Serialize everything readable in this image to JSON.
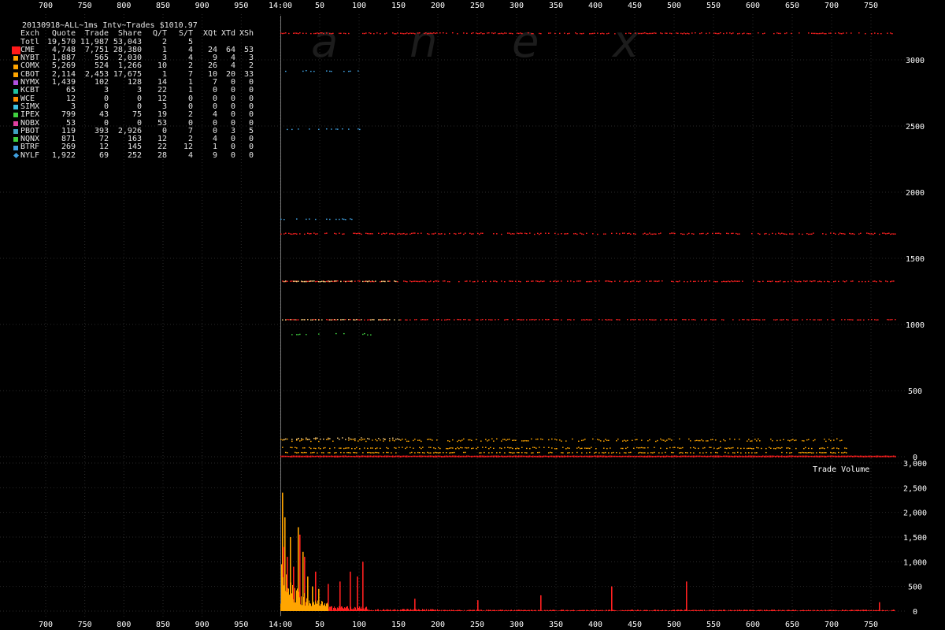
{
  "watermark": [
    "a",
    "n",
    "e",
    "x"
  ],
  "stats": {
    "title": "20130918~ALL~1ms Intv~Trades $1010.97",
    "headers": [
      "Exch",
      "Quote",
      "Trade",
      "Share",
      "Q/T",
      "S/T",
      "XQt",
      "XTd",
      "XSh"
    ],
    "rows": [
      {
        "cells": [
          "Totl",
          "19,570",
          "11,987",
          "53,043",
          "2",
          "5",
          "",
          "",
          ""
        ],
        "color": ""
      },
      {
        "cells": [
          "CME",
          "4,748",
          "7,751",
          "28,380",
          "1",
          "4",
          "24",
          "64",
          "53"
        ],
        "color": "#ff1a1a",
        "big": true
      },
      {
        "cells": [
          "NYBT",
          "1,887",
          "565",
          "2,030",
          "3",
          "4",
          "9",
          "4",
          "3"
        ],
        "color": "#ffa500"
      },
      {
        "cells": [
          "COMX",
          "5,269",
          "524",
          "1,266",
          "10",
          "2",
          "26",
          "4",
          "2"
        ],
        "color": "#ffa500"
      },
      {
        "cells": [
          "CBOT",
          "2,114",
          "2,453",
          "17,675",
          "1",
          "7",
          "10",
          "20",
          "33"
        ],
        "color": "#ffa500"
      },
      {
        "cells": [
          "NYMX",
          "1,439",
          "102",
          "128",
          "14",
          "1",
          "7",
          "0",
          "0"
        ],
        "color": "#b050e0"
      },
      {
        "cells": [
          "KCBT",
          "65",
          "3",
          "3",
          "22",
          "1",
          "0",
          "0",
          "0"
        ],
        "color": "#20c0a0"
      },
      {
        "cells": [
          "WCE",
          "12",
          "0",
          "0",
          "12",
          "0",
          "0",
          "0",
          "0"
        ],
        "color": "#ff8c00"
      },
      {
        "cells": [
          "SIMX",
          "3",
          "0",
          "0",
          "3",
          "0",
          "0",
          "0",
          "0"
        ],
        "color": "#40c0e0"
      },
      {
        "cells": [
          "IPEX",
          "799",
          "43",
          "75",
          "19",
          "2",
          "4",
          "0",
          "0"
        ],
        "color": "#40d040"
      },
      {
        "cells": [
          "NOBX",
          "53",
          "0",
          "0",
          "53",
          "0",
          "0",
          "0",
          "0"
        ],
        "color": "#e040a0"
      },
      {
        "cells": [
          "PBOT",
          "119",
          "393",
          "2,926",
          "0",
          "7",
          "0",
          "3",
          "5"
        ],
        "color": "#40a0c0"
      },
      {
        "cells": [
          "NQNX",
          "871",
          "72",
          "163",
          "12",
          "2",
          "4",
          "0",
          "0"
        ],
        "color": "#40d040"
      },
      {
        "cells": [
          "BTRF",
          "269",
          "12",
          "145",
          "22",
          "12",
          "1",
          "0",
          "0"
        ],
        "color": "#40a0e0"
      },
      {
        "cells": [
          "NYLF",
          "1,922",
          "69",
          "252",
          "28",
          "4",
          "9",
          "0",
          "0"
        ],
        "color": "#40a0e0",
        "diamond": true
      }
    ]
  },
  "chart_data": [
    {
      "type": "scatter",
      "title": "",
      "xlabel": "",
      "ylabel": "",
      "x_ticks": [
        "700",
        "750",
        "800",
        "850",
        "900",
        "950",
        "14:00",
        "50",
        "100",
        "150",
        "200",
        "250",
        "300",
        "350",
        "400",
        "450",
        "500",
        "550",
        "600",
        "650",
        "700",
        "750"
      ],
      "y_ticks": [
        "0",
        "500",
        "1000",
        "1500",
        "2000",
        "2500",
        "3000"
      ],
      "ylim": [
        0,
        3250
      ],
      "x_range_ms": [
        -1010,
        790
      ],
      "series": [
        {
          "color": "#ff2020",
          "bands": [
            [
              3205,
              3.5
            ],
            [
              1690,
              4.5
            ],
            [
              1330,
              3
            ],
            [
              1040,
              2
            ]
          ],
          "x_range": [
            0,
            780
          ],
          "density": 0.55
        },
        {
          "color": "#ff2020",
          "bands": [
            [
              5,
              2
            ],
            [
              8,
              1.5
            ]
          ],
          "x_range": [
            0,
            780
          ],
          "density": 1.0
        },
        {
          "color": "#ffa500",
          "bands": [
            [
              130,
              10
            ],
            [
              70,
              5
            ],
            [
              35,
              2.5
            ]
          ],
          "x_range": [
            0,
            720
          ],
          "density": 0.5
        },
        {
          "color": "#ffd27f",
          "bands": [
            [
              140,
              7
            ],
            [
              1330,
              3
            ],
            [
              1040,
              2
            ]
          ],
          "x_range": [
            0,
            150
          ],
          "density": 0.5
        },
        {
          "color": "#40a0e0",
          "bands": [
            [
              2920,
              3
            ],
            [
              1800,
              3
            ],
            [
              2480,
              2
            ]
          ],
          "x_range": [
            0,
            100
          ],
          "density": 0.3
        },
        {
          "color": "#40d040",
          "bands": [
            [
              930,
              6
            ]
          ],
          "x_range": [
            0,
            120
          ],
          "density": 0.15
        }
      ]
    },
    {
      "type": "bar",
      "title": "Trade Volume",
      "xlabel": "",
      "ylabel": "",
      "x_ticks": [
        "700",
        "750",
        "800",
        "850",
        "900",
        "950",
        "14:00",
        "50",
        "100",
        "150",
        "200",
        "250",
        "300",
        "350",
        "400",
        "450",
        "500",
        "550",
        "600",
        "650",
        "700",
        "750"
      ],
      "y_ticks": [
        "0",
        "500",
        "1,000",
        "1,500",
        "2,000",
        "2,500",
        "3,000"
      ],
      "ylim": [
        0,
        3000
      ],
      "x_range_ms": [
        -1010,
        790
      ],
      "series": [
        {
          "color": "#ffa500",
          "peaks": [
            [
              2,
              2400
            ],
            [
              5,
              1900
            ],
            [
              12,
              1500
            ],
            [
              22,
              1700
            ],
            [
              28,
              1200
            ],
            [
              34,
              700
            ],
            [
              40,
              500
            ],
            [
              48,
              450
            ]
          ]
        },
        {
          "color": "#ff2020",
          "peaks": [
            [
              3,
              1300
            ],
            [
              8,
              1100
            ],
            [
              16,
              900
            ],
            [
              24,
              1550
            ],
            [
              30,
              1100
            ],
            [
              44,
              800
            ],
            [
              60,
              550
            ],
            [
              75,
              600
            ],
            [
              88,
              800
            ],
            [
              97,
              700
            ],
            [
              104,
              1000
            ],
            [
              170,
              250
            ],
            [
              250,
              220
            ],
            [
              330,
              320
            ],
            [
              420,
              500
            ],
            [
              515,
              600
            ],
            [
              760,
              180
            ]
          ]
        }
      ]
    }
  ]
}
